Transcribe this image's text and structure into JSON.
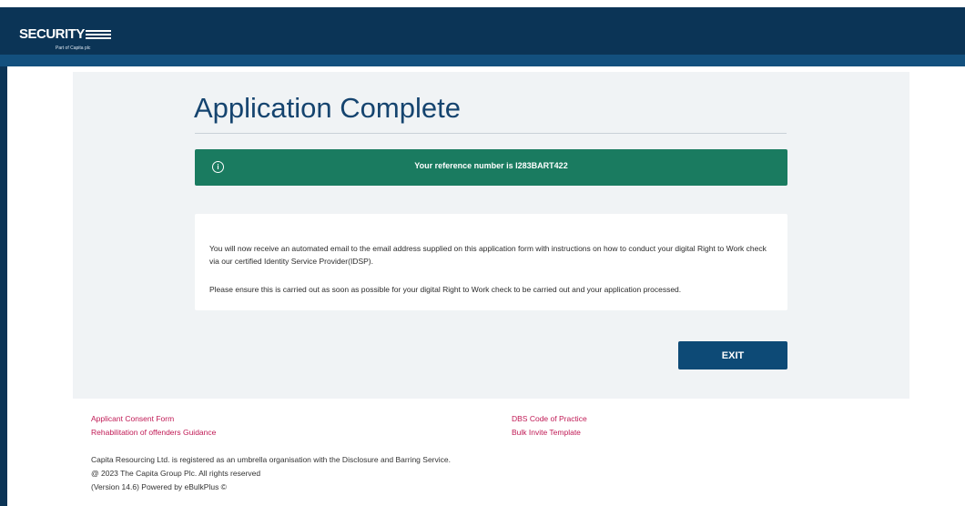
{
  "header": {
    "logo_text": "SECURITY",
    "logo_subtext": "Part of Capita plc"
  },
  "main": {
    "title": "Application Complete",
    "reference_banner": {
      "icon": "info-icon",
      "icon_glyph": "i",
      "text": "Your reference number is I283BART422",
      "color": "#1a7b60"
    },
    "info_paragraph_1": "You will now receive an automated email to the email address supplied on this application form with instructions on how to conduct your digital Right to Work check via our certified Identity Service Provider(IDSP).",
    "info_paragraph_2": "Please ensure this is carried out as soon as possible for your digital Right to Work check to be carried out and your application processed.",
    "exit_label": "EXIT"
  },
  "footer": {
    "links_left": [
      "Applicant Consent Form",
      "Rehabilitation of offenders Guidance"
    ],
    "links_right": [
      "DBS Code of Practice",
      "Bulk Invite Template"
    ],
    "registration_text": "Capita Resourcing Ltd. is registered as an umbrella organisation with the Disclosure and Barring Service.",
    "copyright": "@ 2023 The Capita Group Plc. All rights reserved",
    "version": "(Version 14.6) Powered by eBulkPlus ©",
    "link_color": "#c01a55"
  },
  "colors": {
    "header_bg": "#0b3456",
    "accent": "#15446f",
    "button": "#0d4a76"
  }
}
